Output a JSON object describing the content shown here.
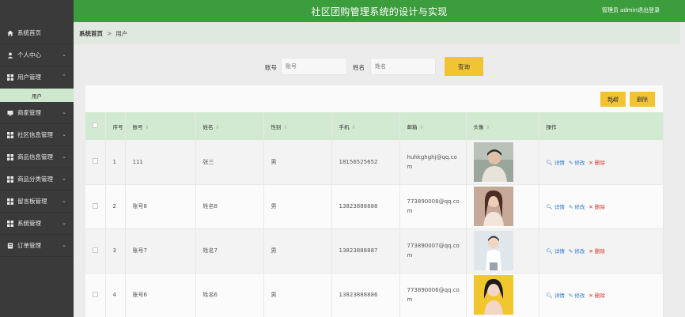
{
  "header": {
    "title": "社区团购管理系统的设计与实现",
    "user": "管理员 admin",
    "logout": "退出登录"
  },
  "sidebar": {
    "items": [
      {
        "label": "系统首页",
        "icon": "home-icon",
        "chevron": false
      },
      {
        "label": "个人中心",
        "icon": "person-icon",
        "chevron": true
      },
      {
        "label": "用户管理",
        "icon": "grid-icon",
        "chevron": true,
        "expanded": true
      },
      {
        "label": "商家管理",
        "icon": "shop-icon",
        "chevron": true
      },
      {
        "label": "社区信息管理",
        "icon": "grid-icon",
        "chevron": true
      },
      {
        "label": "商品信息管理",
        "icon": "grid-icon",
        "chevron": true
      },
      {
        "label": "商品分类管理",
        "icon": "grid-icon",
        "chevron": true
      },
      {
        "label": "留言板管理",
        "icon": "grid-icon",
        "chevron": true
      },
      {
        "label": "系统管理",
        "icon": "grid-icon",
        "chevron": true
      },
      {
        "label": "订单管理",
        "icon": "order-icon",
        "chevron": true
      }
    ],
    "sub_item": "用户"
  },
  "breadcrumb": {
    "home": "系统首页",
    "sep": ">",
    "current": "用户"
  },
  "search": {
    "account_label": "账号",
    "account_placeholder": "账号",
    "name_label": "姓名",
    "name_placeholder": "姓名",
    "query_button": "查询"
  },
  "toolbar": {
    "add": "新增",
    "delete": "删除"
  },
  "table": {
    "headers": [
      "",
      "序号",
      "账号",
      "姓名",
      "性别",
      "手机",
      "邮箱",
      "头像",
      "操作"
    ],
    "rows": [
      {
        "index": "1",
        "account": "111",
        "name": "张三",
        "gender": "男",
        "phone": "18156525652",
        "email": "huhkghghj@qq.com"
      },
      {
        "index": "2",
        "account": "账号8",
        "name": "姓名8",
        "gender": "男",
        "phone": "13823888888",
        "email": "773890008@qq.com"
      },
      {
        "index": "3",
        "account": "账号7",
        "name": "姓名7",
        "gender": "男",
        "phone": "13823888887",
        "email": "773890007@qq.com"
      },
      {
        "index": "4",
        "account": "账号6",
        "name": "姓名6",
        "gender": "男",
        "phone": "13823888886",
        "email": "773890006@qq.com"
      }
    ],
    "actions": {
      "detail": "详情",
      "edit": "修改",
      "delete": "删除"
    }
  },
  "colors": {
    "header_bg": "#3c9d3c",
    "sidebar_bg": "#3a3a3a",
    "accent_button": "#f2c434",
    "table_header_bg": "#d2e9d2",
    "link_blue": "#2e7bcf",
    "delete_red": "#d9342b"
  }
}
